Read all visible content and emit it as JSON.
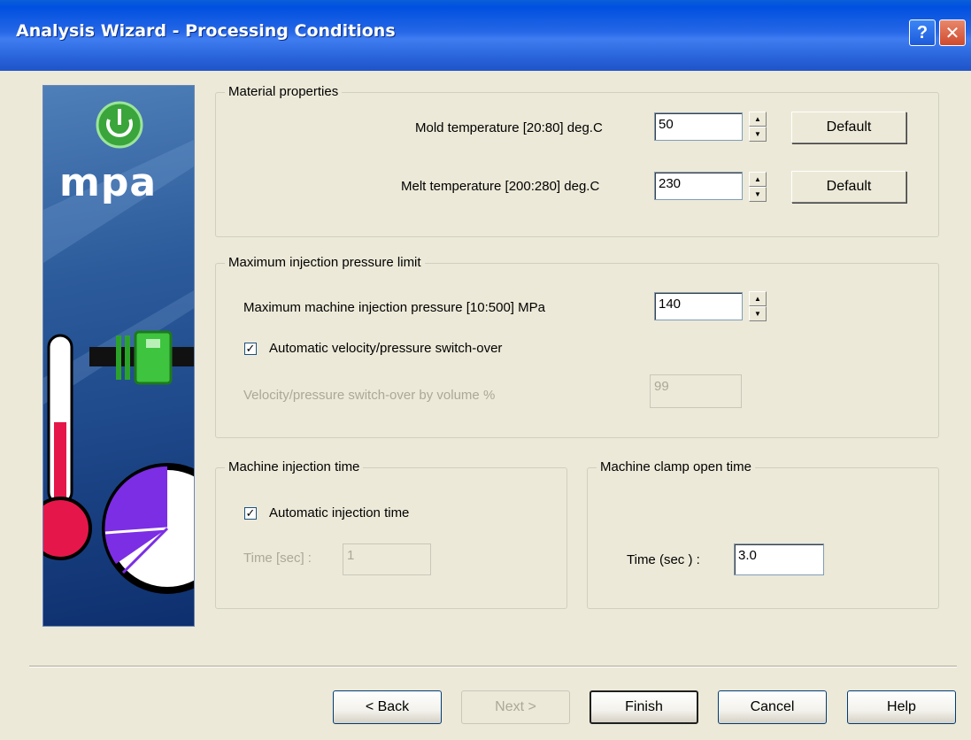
{
  "window": {
    "title": "Analysis Wizard - Processing Conditions",
    "help_glyph": "?",
    "close_glyph": "✕"
  },
  "side_image": {
    "logo_text": "mpa"
  },
  "material": {
    "title": "Material properties",
    "mold_label": "Mold temperature [20:80] deg.C",
    "mold_value": "50",
    "melt_label": "Melt temperature [200:280] deg.C",
    "melt_value": "230",
    "default_label": "Default"
  },
  "pressure": {
    "title": "Maximum injection pressure limit",
    "max_label": "Maximum machine injection pressure [10:500] MPa",
    "max_value": "140",
    "auto_switch_label": "Automatic velocity/pressure switch-over",
    "auto_switch_checked": true,
    "volume_label": "Velocity/pressure switch-over by volume %",
    "volume_value": "99"
  },
  "injection_time": {
    "title": "Machine injection time",
    "auto_label": "Automatic injection time",
    "auto_checked": true,
    "time_label": "Time [sec] :",
    "time_value": "1"
  },
  "clamp_time": {
    "title": "Machine clamp open time",
    "time_label": "Time (sec ) :",
    "time_value": "3.0"
  },
  "buttons": {
    "back": "< Back",
    "next": "Next >",
    "finish": "Finish",
    "cancel": "Cancel",
    "help": "Help"
  },
  "colors": {
    "titlebar": "#2667e6",
    "dialog_bg": "#ece9d8",
    "side_panel": "#2c5b9b"
  }
}
